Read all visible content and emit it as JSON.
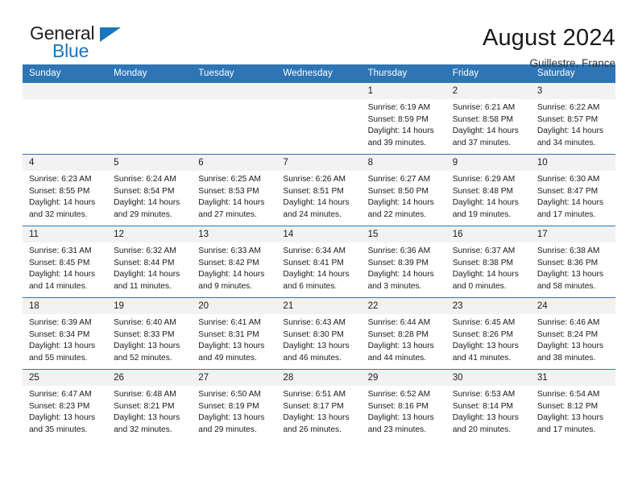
{
  "brand": {
    "name_part1": "General",
    "name_part2": "Blue",
    "flag_icon": "triangle-flag-icon"
  },
  "header": {
    "title": "August 2024",
    "location": "Guillestre, France"
  },
  "calendar": {
    "weekday_headers": [
      "Sunday",
      "Monday",
      "Tuesday",
      "Wednesday",
      "Thursday",
      "Friday",
      "Saturday"
    ],
    "accent_color": "#2e75b6",
    "daynum_bg": "#f2f2f2",
    "weeks": [
      [
        {
          "day": "",
          "blank": true,
          "sunrise": "",
          "sunset": "",
          "daylight1": "",
          "daylight2": ""
        },
        {
          "day": "",
          "blank": true,
          "sunrise": "",
          "sunset": "",
          "daylight1": "",
          "daylight2": ""
        },
        {
          "day": "",
          "blank": true,
          "sunrise": "",
          "sunset": "",
          "daylight1": "",
          "daylight2": ""
        },
        {
          "day": "",
          "blank": true,
          "sunrise": "",
          "sunset": "",
          "daylight1": "",
          "daylight2": ""
        },
        {
          "day": "1",
          "blank": false,
          "sunrise": "Sunrise: 6:19 AM",
          "sunset": "Sunset: 8:59 PM",
          "daylight1": "Daylight: 14 hours",
          "daylight2": "and 39 minutes."
        },
        {
          "day": "2",
          "blank": false,
          "sunrise": "Sunrise: 6:21 AM",
          "sunset": "Sunset: 8:58 PM",
          "daylight1": "Daylight: 14 hours",
          "daylight2": "and 37 minutes."
        },
        {
          "day": "3",
          "blank": false,
          "sunrise": "Sunrise: 6:22 AM",
          "sunset": "Sunset: 8:57 PM",
          "daylight1": "Daylight: 14 hours",
          "daylight2": "and 34 minutes."
        }
      ],
      [
        {
          "day": "4",
          "blank": false,
          "sunrise": "Sunrise: 6:23 AM",
          "sunset": "Sunset: 8:55 PM",
          "daylight1": "Daylight: 14 hours",
          "daylight2": "and 32 minutes."
        },
        {
          "day": "5",
          "blank": false,
          "sunrise": "Sunrise: 6:24 AM",
          "sunset": "Sunset: 8:54 PM",
          "daylight1": "Daylight: 14 hours",
          "daylight2": "and 29 minutes."
        },
        {
          "day": "6",
          "blank": false,
          "sunrise": "Sunrise: 6:25 AM",
          "sunset": "Sunset: 8:53 PM",
          "daylight1": "Daylight: 14 hours",
          "daylight2": "and 27 minutes."
        },
        {
          "day": "7",
          "blank": false,
          "sunrise": "Sunrise: 6:26 AM",
          "sunset": "Sunset: 8:51 PM",
          "daylight1": "Daylight: 14 hours",
          "daylight2": "and 24 minutes."
        },
        {
          "day": "8",
          "blank": false,
          "sunrise": "Sunrise: 6:27 AM",
          "sunset": "Sunset: 8:50 PM",
          "daylight1": "Daylight: 14 hours",
          "daylight2": "and 22 minutes."
        },
        {
          "day": "9",
          "blank": false,
          "sunrise": "Sunrise: 6:29 AM",
          "sunset": "Sunset: 8:48 PM",
          "daylight1": "Daylight: 14 hours",
          "daylight2": "and 19 minutes."
        },
        {
          "day": "10",
          "blank": false,
          "sunrise": "Sunrise: 6:30 AM",
          "sunset": "Sunset: 8:47 PM",
          "daylight1": "Daylight: 14 hours",
          "daylight2": "and 17 minutes."
        }
      ],
      [
        {
          "day": "11",
          "blank": false,
          "sunrise": "Sunrise: 6:31 AM",
          "sunset": "Sunset: 8:45 PM",
          "daylight1": "Daylight: 14 hours",
          "daylight2": "and 14 minutes."
        },
        {
          "day": "12",
          "blank": false,
          "sunrise": "Sunrise: 6:32 AM",
          "sunset": "Sunset: 8:44 PM",
          "daylight1": "Daylight: 14 hours",
          "daylight2": "and 11 minutes."
        },
        {
          "day": "13",
          "blank": false,
          "sunrise": "Sunrise: 6:33 AM",
          "sunset": "Sunset: 8:42 PM",
          "daylight1": "Daylight: 14 hours",
          "daylight2": "and 9 minutes."
        },
        {
          "day": "14",
          "blank": false,
          "sunrise": "Sunrise: 6:34 AM",
          "sunset": "Sunset: 8:41 PM",
          "daylight1": "Daylight: 14 hours",
          "daylight2": "and 6 minutes."
        },
        {
          "day": "15",
          "blank": false,
          "sunrise": "Sunrise: 6:36 AM",
          "sunset": "Sunset: 8:39 PM",
          "daylight1": "Daylight: 14 hours",
          "daylight2": "and 3 minutes."
        },
        {
          "day": "16",
          "blank": false,
          "sunrise": "Sunrise: 6:37 AM",
          "sunset": "Sunset: 8:38 PM",
          "daylight1": "Daylight: 14 hours",
          "daylight2": "and 0 minutes."
        },
        {
          "day": "17",
          "blank": false,
          "sunrise": "Sunrise: 6:38 AM",
          "sunset": "Sunset: 8:36 PM",
          "daylight1": "Daylight: 13 hours",
          "daylight2": "and 58 minutes."
        }
      ],
      [
        {
          "day": "18",
          "blank": false,
          "sunrise": "Sunrise: 6:39 AM",
          "sunset": "Sunset: 8:34 PM",
          "daylight1": "Daylight: 13 hours",
          "daylight2": "and 55 minutes."
        },
        {
          "day": "19",
          "blank": false,
          "sunrise": "Sunrise: 6:40 AM",
          "sunset": "Sunset: 8:33 PM",
          "daylight1": "Daylight: 13 hours",
          "daylight2": "and 52 minutes."
        },
        {
          "day": "20",
          "blank": false,
          "sunrise": "Sunrise: 6:41 AM",
          "sunset": "Sunset: 8:31 PM",
          "daylight1": "Daylight: 13 hours",
          "daylight2": "and 49 minutes."
        },
        {
          "day": "21",
          "blank": false,
          "sunrise": "Sunrise: 6:43 AM",
          "sunset": "Sunset: 8:30 PM",
          "daylight1": "Daylight: 13 hours",
          "daylight2": "and 46 minutes."
        },
        {
          "day": "22",
          "blank": false,
          "sunrise": "Sunrise: 6:44 AM",
          "sunset": "Sunset: 8:28 PM",
          "daylight1": "Daylight: 13 hours",
          "daylight2": "and 44 minutes."
        },
        {
          "day": "23",
          "blank": false,
          "sunrise": "Sunrise: 6:45 AM",
          "sunset": "Sunset: 8:26 PM",
          "daylight1": "Daylight: 13 hours",
          "daylight2": "and 41 minutes."
        },
        {
          "day": "24",
          "blank": false,
          "sunrise": "Sunrise: 6:46 AM",
          "sunset": "Sunset: 8:24 PM",
          "daylight1": "Daylight: 13 hours",
          "daylight2": "and 38 minutes."
        }
      ],
      [
        {
          "day": "25",
          "blank": false,
          "sunrise": "Sunrise: 6:47 AM",
          "sunset": "Sunset: 8:23 PM",
          "daylight1": "Daylight: 13 hours",
          "daylight2": "and 35 minutes."
        },
        {
          "day": "26",
          "blank": false,
          "sunrise": "Sunrise: 6:48 AM",
          "sunset": "Sunset: 8:21 PM",
          "daylight1": "Daylight: 13 hours",
          "daylight2": "and 32 minutes."
        },
        {
          "day": "27",
          "blank": false,
          "sunrise": "Sunrise: 6:50 AM",
          "sunset": "Sunset: 8:19 PM",
          "daylight1": "Daylight: 13 hours",
          "daylight2": "and 29 minutes."
        },
        {
          "day": "28",
          "blank": false,
          "sunrise": "Sunrise: 6:51 AM",
          "sunset": "Sunset: 8:17 PM",
          "daylight1": "Daylight: 13 hours",
          "daylight2": "and 26 minutes."
        },
        {
          "day": "29",
          "blank": false,
          "sunrise": "Sunrise: 6:52 AM",
          "sunset": "Sunset: 8:16 PM",
          "daylight1": "Daylight: 13 hours",
          "daylight2": "and 23 minutes."
        },
        {
          "day": "30",
          "blank": false,
          "sunrise": "Sunrise: 6:53 AM",
          "sunset": "Sunset: 8:14 PM",
          "daylight1": "Daylight: 13 hours",
          "daylight2": "and 20 minutes."
        },
        {
          "day": "31",
          "blank": false,
          "sunrise": "Sunrise: 6:54 AM",
          "sunset": "Sunset: 8:12 PM",
          "daylight1": "Daylight: 13 hours",
          "daylight2": "and 17 minutes."
        }
      ]
    ]
  }
}
